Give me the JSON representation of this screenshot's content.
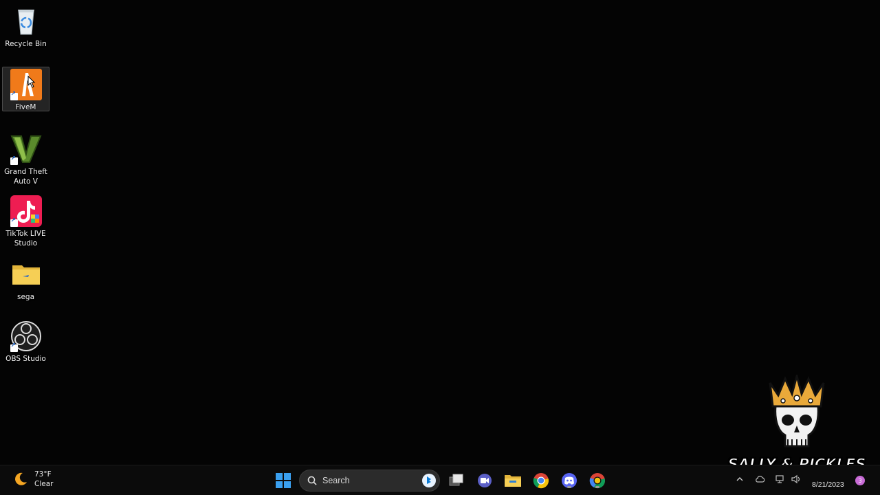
{
  "desktop": {
    "icons": [
      {
        "label": "Recycle Bin",
        "icon": "recycle-bin-icon"
      },
      {
        "label": "FiveM",
        "icon": "fivem-icon"
      },
      {
        "label": "Grand Theft Auto V",
        "icon": "gta-v-icon"
      },
      {
        "label": "TikTok LIVE Studio",
        "icon": "tiktok-live-studio-icon"
      },
      {
        "label": "sega",
        "icon": "folder-icon"
      },
      {
        "label": "OBS Studio",
        "icon": "obs-studio-icon"
      }
    ]
  },
  "taskbar": {
    "weather": {
      "temp": "73°F",
      "condition": "Clear",
      "icon": "moon-icon"
    },
    "search": {
      "placeholder": "Search"
    },
    "apps": [
      "start-icon",
      "task-view-icon",
      "teams-meet-icon",
      "file-explorer-icon",
      "chrome-icon",
      "discord-icon",
      "chrome-alt-icon"
    ],
    "clock": {
      "date": "8/21/2023"
    }
  },
  "watermark": {
    "text": "SALLY & PICKLES"
  },
  "colors": {
    "accent": "#0a84ff",
    "desktop_bg": "#040404",
    "taskbar_bg": "#0b0b0b"
  }
}
